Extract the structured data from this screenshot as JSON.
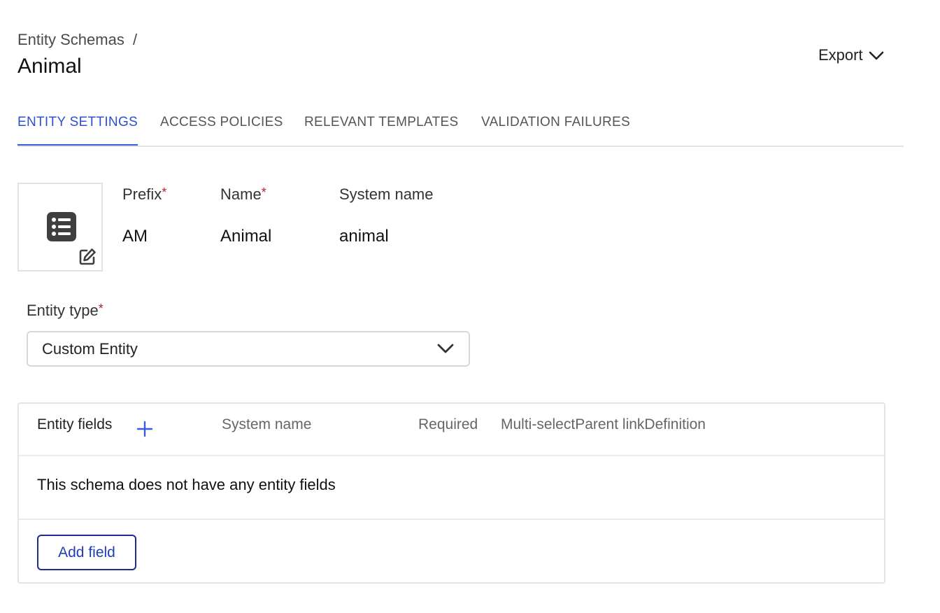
{
  "header": {
    "breadcrumb_parent": "Entity Schemas",
    "breadcrumb_separator": "/",
    "title": "Animal",
    "export_label": "Export",
    "export_icon": "chevron-down-icon"
  },
  "tabs": [
    {
      "label": "ENTITY SETTINGS",
      "active": true
    },
    {
      "label": "ACCESS POLICIES",
      "active": false
    },
    {
      "label": "RELEVANT TEMPLATES",
      "active": false
    },
    {
      "label": "VALIDATION FAILURES",
      "active": false
    }
  ],
  "schema_icon": {
    "icon": "list-icon",
    "edit_icon": "edit-icon"
  },
  "fields": {
    "prefix": {
      "label": "Prefix",
      "required": "*",
      "value": "AM"
    },
    "name": {
      "label": "Name",
      "required": "*",
      "value": "Animal"
    },
    "system_name": {
      "label": "System name",
      "value": "animal"
    }
  },
  "entity_type": {
    "label": "Entity type",
    "required": "*",
    "selected": "Custom Entity"
  },
  "entity_fields": {
    "columns": {
      "entity_fields": "Entity fields",
      "system_name": "System name",
      "required": "Required",
      "multi_select": "Multi-select",
      "parent_link": "Parent link",
      "definition": "Definition"
    },
    "empty_message": "This schema does not have any entity fields",
    "add_button_label": "Add field"
  },
  "colors": {
    "accent": "#3b5bdb",
    "required_marker": "#b0252a",
    "button_border": "#1e2b8f"
  }
}
